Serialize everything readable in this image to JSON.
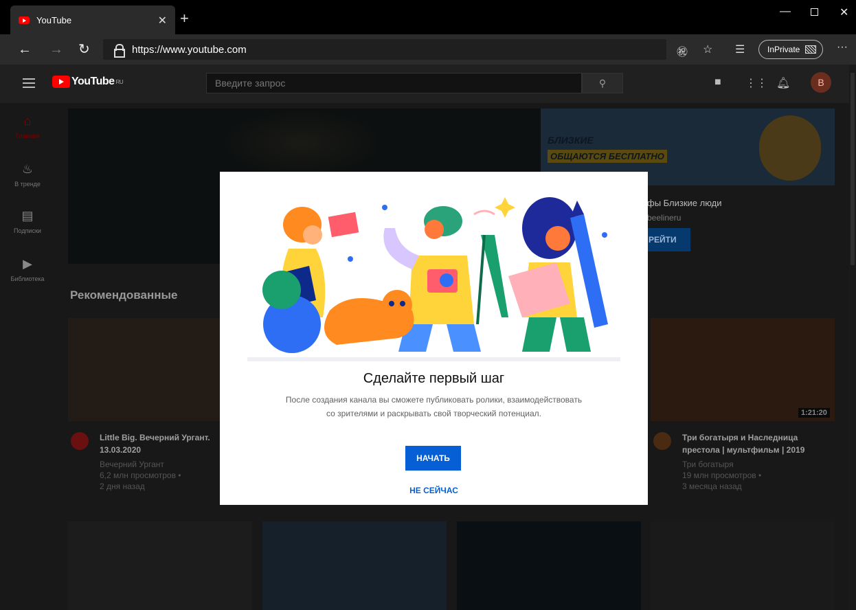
{
  "browser": {
    "tab_title": "YouTube",
    "tab_close": "✕",
    "new_tab": "+",
    "url_scheme": "https://",
    "url_host": "www.youtube.com",
    "inprivate_label": "InPrivate",
    "more": "···",
    "icons": [
      "back-arrow",
      "forward-arrow",
      "refresh",
      "lock",
      "read-aloud",
      "favorite-star",
      "favorites-list",
      "inprivate",
      "more-dots"
    ]
  },
  "youtube": {
    "logo_text": "YouTube",
    "logo_region": "RU",
    "search_placeholder": "Введите запрос",
    "avatar_letter": "B",
    "sidebar": [
      {
        "label": "Главная",
        "icon": "home-icon",
        "active": true
      },
      {
        "label": "В тренде",
        "icon": "fire-icon",
        "active": false
      },
      {
        "label": "Подписки",
        "icon": "subscriptions-icon",
        "active": false
      },
      {
        "label": "Библиотека",
        "icon": "library-icon",
        "active": false
      }
    ],
    "ad": {
      "title": "БЛИЗКИЕ",
      "subtitle": "ОБЩАЮТСЯ БЕСПЛАТНО",
      "text": "фы Близкие люди",
      "channel": "beelineru",
      "button": "РЕЙТИ"
    },
    "section_title": "Рекомендованные",
    "videos": [
      {
        "title": "Little Big. Вечерний Ургант. 13.03.2020",
        "channel": "Вечерний Ургант",
        "views": "6,2 млн просмотров •",
        "age": "2 дня назад"
      },
      {
        "title": "Три богатыря и Наследница престола | мультфильм | 2019",
        "channel": "Три богатыря",
        "views": "19 млн просмотров •",
        "age": "3 месяца назад",
        "duration": "1:21:20"
      }
    ]
  },
  "modal": {
    "title": "Сделайте первый шаг",
    "body": "После создания канала вы сможете публиковать ролики, взаимодействовать со зрителями и раскрывать свой творческий потенциал.",
    "primary_button": "НАЧАТЬ",
    "secondary_button": "НЕ СЕЙЧАС"
  },
  "colors": {
    "accent": "#065fd4",
    "youtube_red": "#ff0000"
  }
}
